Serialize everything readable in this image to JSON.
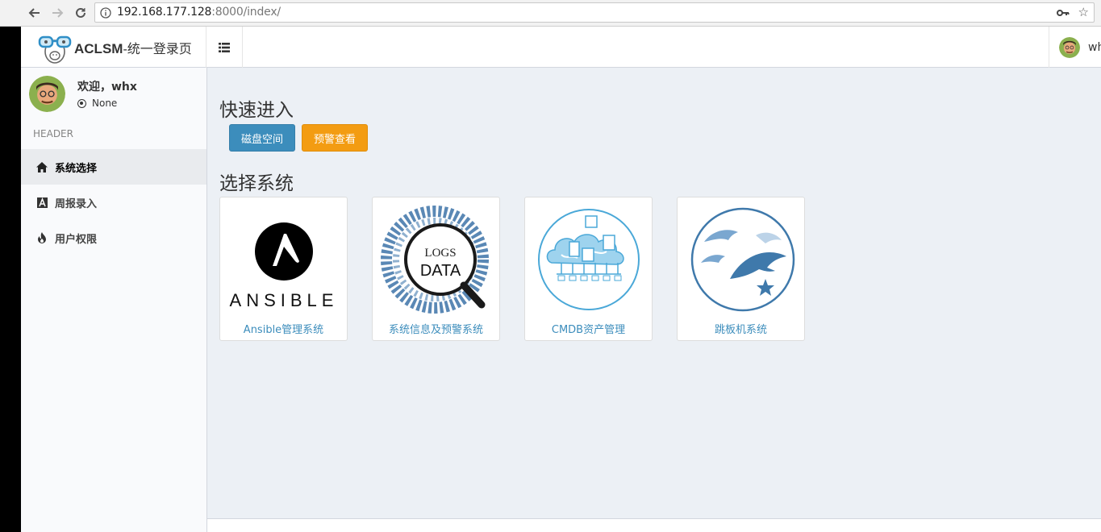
{
  "browser": {
    "url_host": "192.168.177.128",
    "url_rest": ":8000/index/"
  },
  "header": {
    "brand_bold": "ACLSM",
    "brand_rest": "-统一登录页",
    "user_name": "whx"
  },
  "sidebar": {
    "welcome": "欢迎，whx",
    "status": "None",
    "section_header": "HEADER",
    "items": [
      {
        "label": "系统选择",
        "icon": "home-icon"
      },
      {
        "label": "周报录入",
        "icon": "font-icon"
      },
      {
        "label": "用户权限",
        "icon": "fire-icon"
      }
    ]
  },
  "main": {
    "quick_title": "快速进入",
    "quick_buttons": [
      {
        "label": "磁盘空间",
        "color": "#3c8dbc"
      },
      {
        "label": "预警查看",
        "color": "#f39c12"
      }
    ],
    "systems_title": "选择系统",
    "systems": [
      {
        "label": "Ansible管理系统",
        "logo_text": "ANSIBLE"
      },
      {
        "label": "系统信息及预警系统",
        "logo_text_1": "LOGS",
        "logo_text_2": "DATA"
      },
      {
        "label": "CMDB资产管理"
      },
      {
        "label": "跳板机系统"
      }
    ]
  },
  "colors": {
    "accent_blue": "#3c8dbc",
    "accent_orange": "#f39c12",
    "content_bg": "#ecf0f5"
  }
}
